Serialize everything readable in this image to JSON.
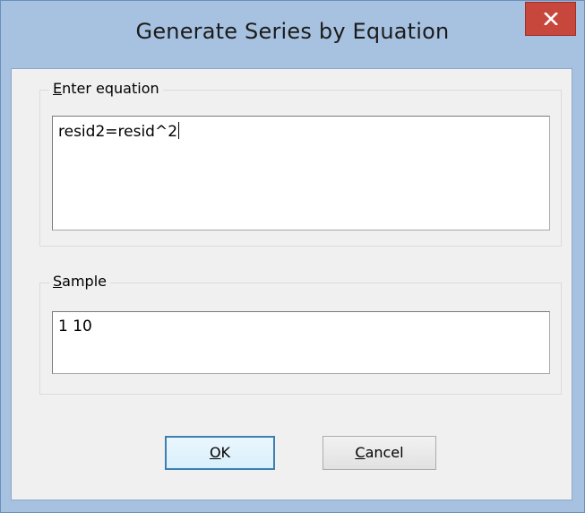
{
  "window": {
    "title": "Generate Series by Equation",
    "close_icon": "close-icon"
  },
  "equation_group": {
    "label_accel": "E",
    "label_rest": "nter equation",
    "value": "resid2=resid^2"
  },
  "sample_group": {
    "label_accel": "S",
    "label_rest": "ample",
    "value": "1 10"
  },
  "buttons": {
    "ok_accel": "O",
    "ok_rest": "K",
    "cancel_accel": "C",
    "cancel_rest": "ancel"
  },
  "colors": {
    "frame": "#a7c2e0",
    "close": "#c7473d",
    "client": "#f0f0f0"
  }
}
